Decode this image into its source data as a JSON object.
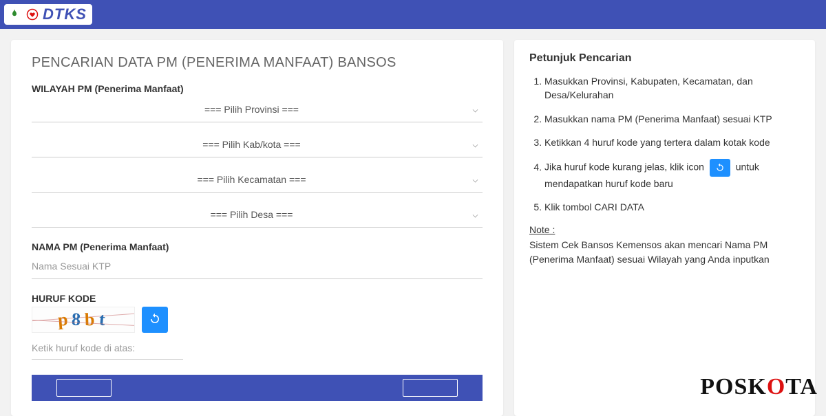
{
  "header": {
    "brand": "DTKS"
  },
  "main": {
    "title": "PENCARIAN DATA PM (PENERIMA MANFAAT) BANSOS",
    "wilayah_label": "WILAYAH PM (Penerima Manfaat)",
    "selects": {
      "provinsi": "=== Pilih Provinsi ===",
      "kabkota": "=== Pilih Kab/kota ===",
      "kecamatan": "=== Pilih Kecamatan ===",
      "desa": "=== Pilih Desa ==="
    },
    "nama_label": "NAMA PM (Penerima Manfaat)",
    "nama_placeholder": "Nama Sesuai KTP",
    "kode_label": "HURUF KODE",
    "captcha_chars": [
      "p",
      "8",
      "b",
      "t"
    ],
    "captcha_placeholder": "Ketik huruf kode di atas:"
  },
  "sidebar": {
    "title": "Petunjuk Pencarian",
    "items": [
      "Masukkan Provinsi, Kabupaten, Kecamatan, dan Desa/Kelurahan",
      "Masukkan nama PM (Penerima Manfaat) sesuai KTP",
      "Ketikkan 4 huruf kode yang tertera dalam kotak kode",
      {
        "pre": "Jika huruf kode kurang jelas, klik icon",
        "post": "untuk mendapatkan huruf kode baru"
      },
      "Klik tombol CARI DATA"
    ],
    "note_label": "Note :",
    "note_body": "Sistem Cek Bansos Kemensos akan mencari Nama PM (Penerima Manfaat) sesuai Wilayah yang Anda inputkan"
  },
  "watermark": {
    "pre": "POSK",
    "accent": "O",
    "post": "TA"
  }
}
